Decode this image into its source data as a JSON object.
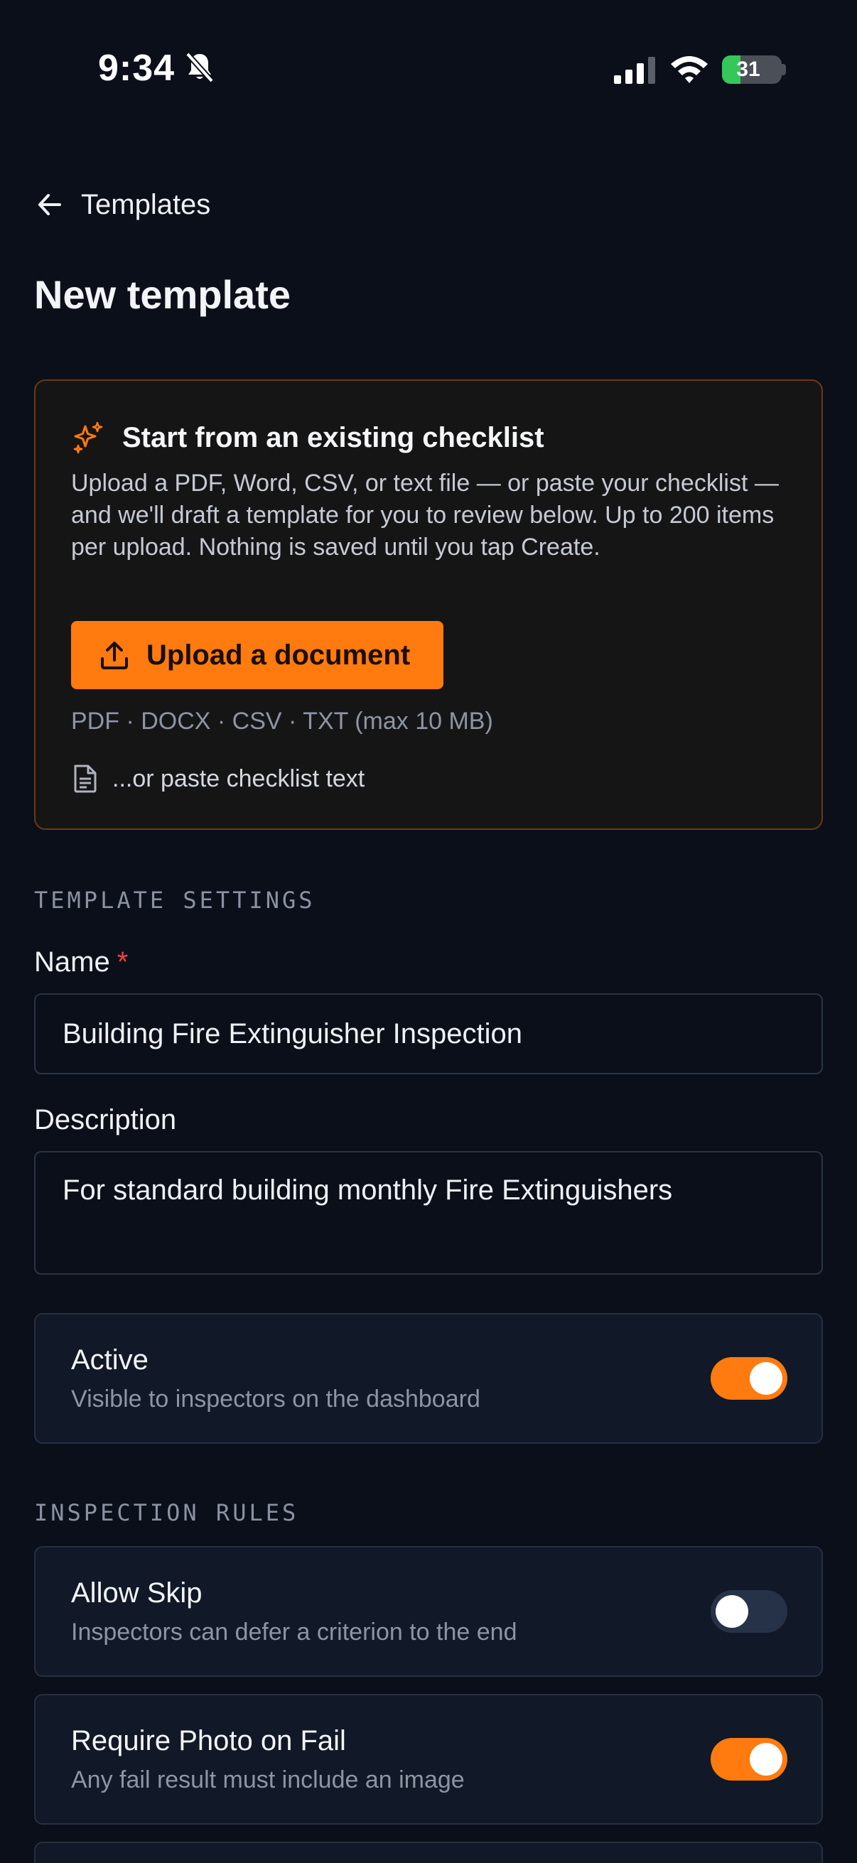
{
  "status_bar": {
    "time": "9:34",
    "battery": "31",
    "battery_level": 0.31
  },
  "nav": {
    "back_label": "Templates"
  },
  "page": {
    "title": "New template"
  },
  "import_card": {
    "title": "Start from an existing checklist",
    "description": "Upload a PDF, Word, CSV, or text file — or paste your checklist — and we'll draft a template for you to review below. Up to 200 items per upload. Nothing is saved until you tap Create.",
    "upload_label": "Upload a document",
    "formats": "PDF · DOCX · CSV · TXT (max 10 MB)",
    "paste_label": "...or paste checklist text"
  },
  "template_settings": {
    "section_label": "TEMPLATE SETTINGS",
    "name_label": "Name",
    "name_required": "*",
    "name_value": "Building Fire Extinguisher Inspection",
    "description_label": "Description",
    "description_value": "For standard building monthly Fire Extinguishers",
    "active": {
      "title": "Active",
      "subtitle": "Visible to inspectors on the dashboard",
      "on": true
    }
  },
  "inspection_rules": {
    "section_label": "INSPECTION RULES",
    "allow_skip": {
      "title": "Allow Skip",
      "subtitle": "Inspectors can defer a criterion to the end",
      "on": false
    },
    "require_photo": {
      "title": "Require Photo on Fail",
      "subtitle": "Any fail result must include an image",
      "on": true
    }
  },
  "colors": {
    "accent": "#ff7a0f",
    "background": "#0b0f19",
    "card": "#111827",
    "required": "#ef4444"
  }
}
